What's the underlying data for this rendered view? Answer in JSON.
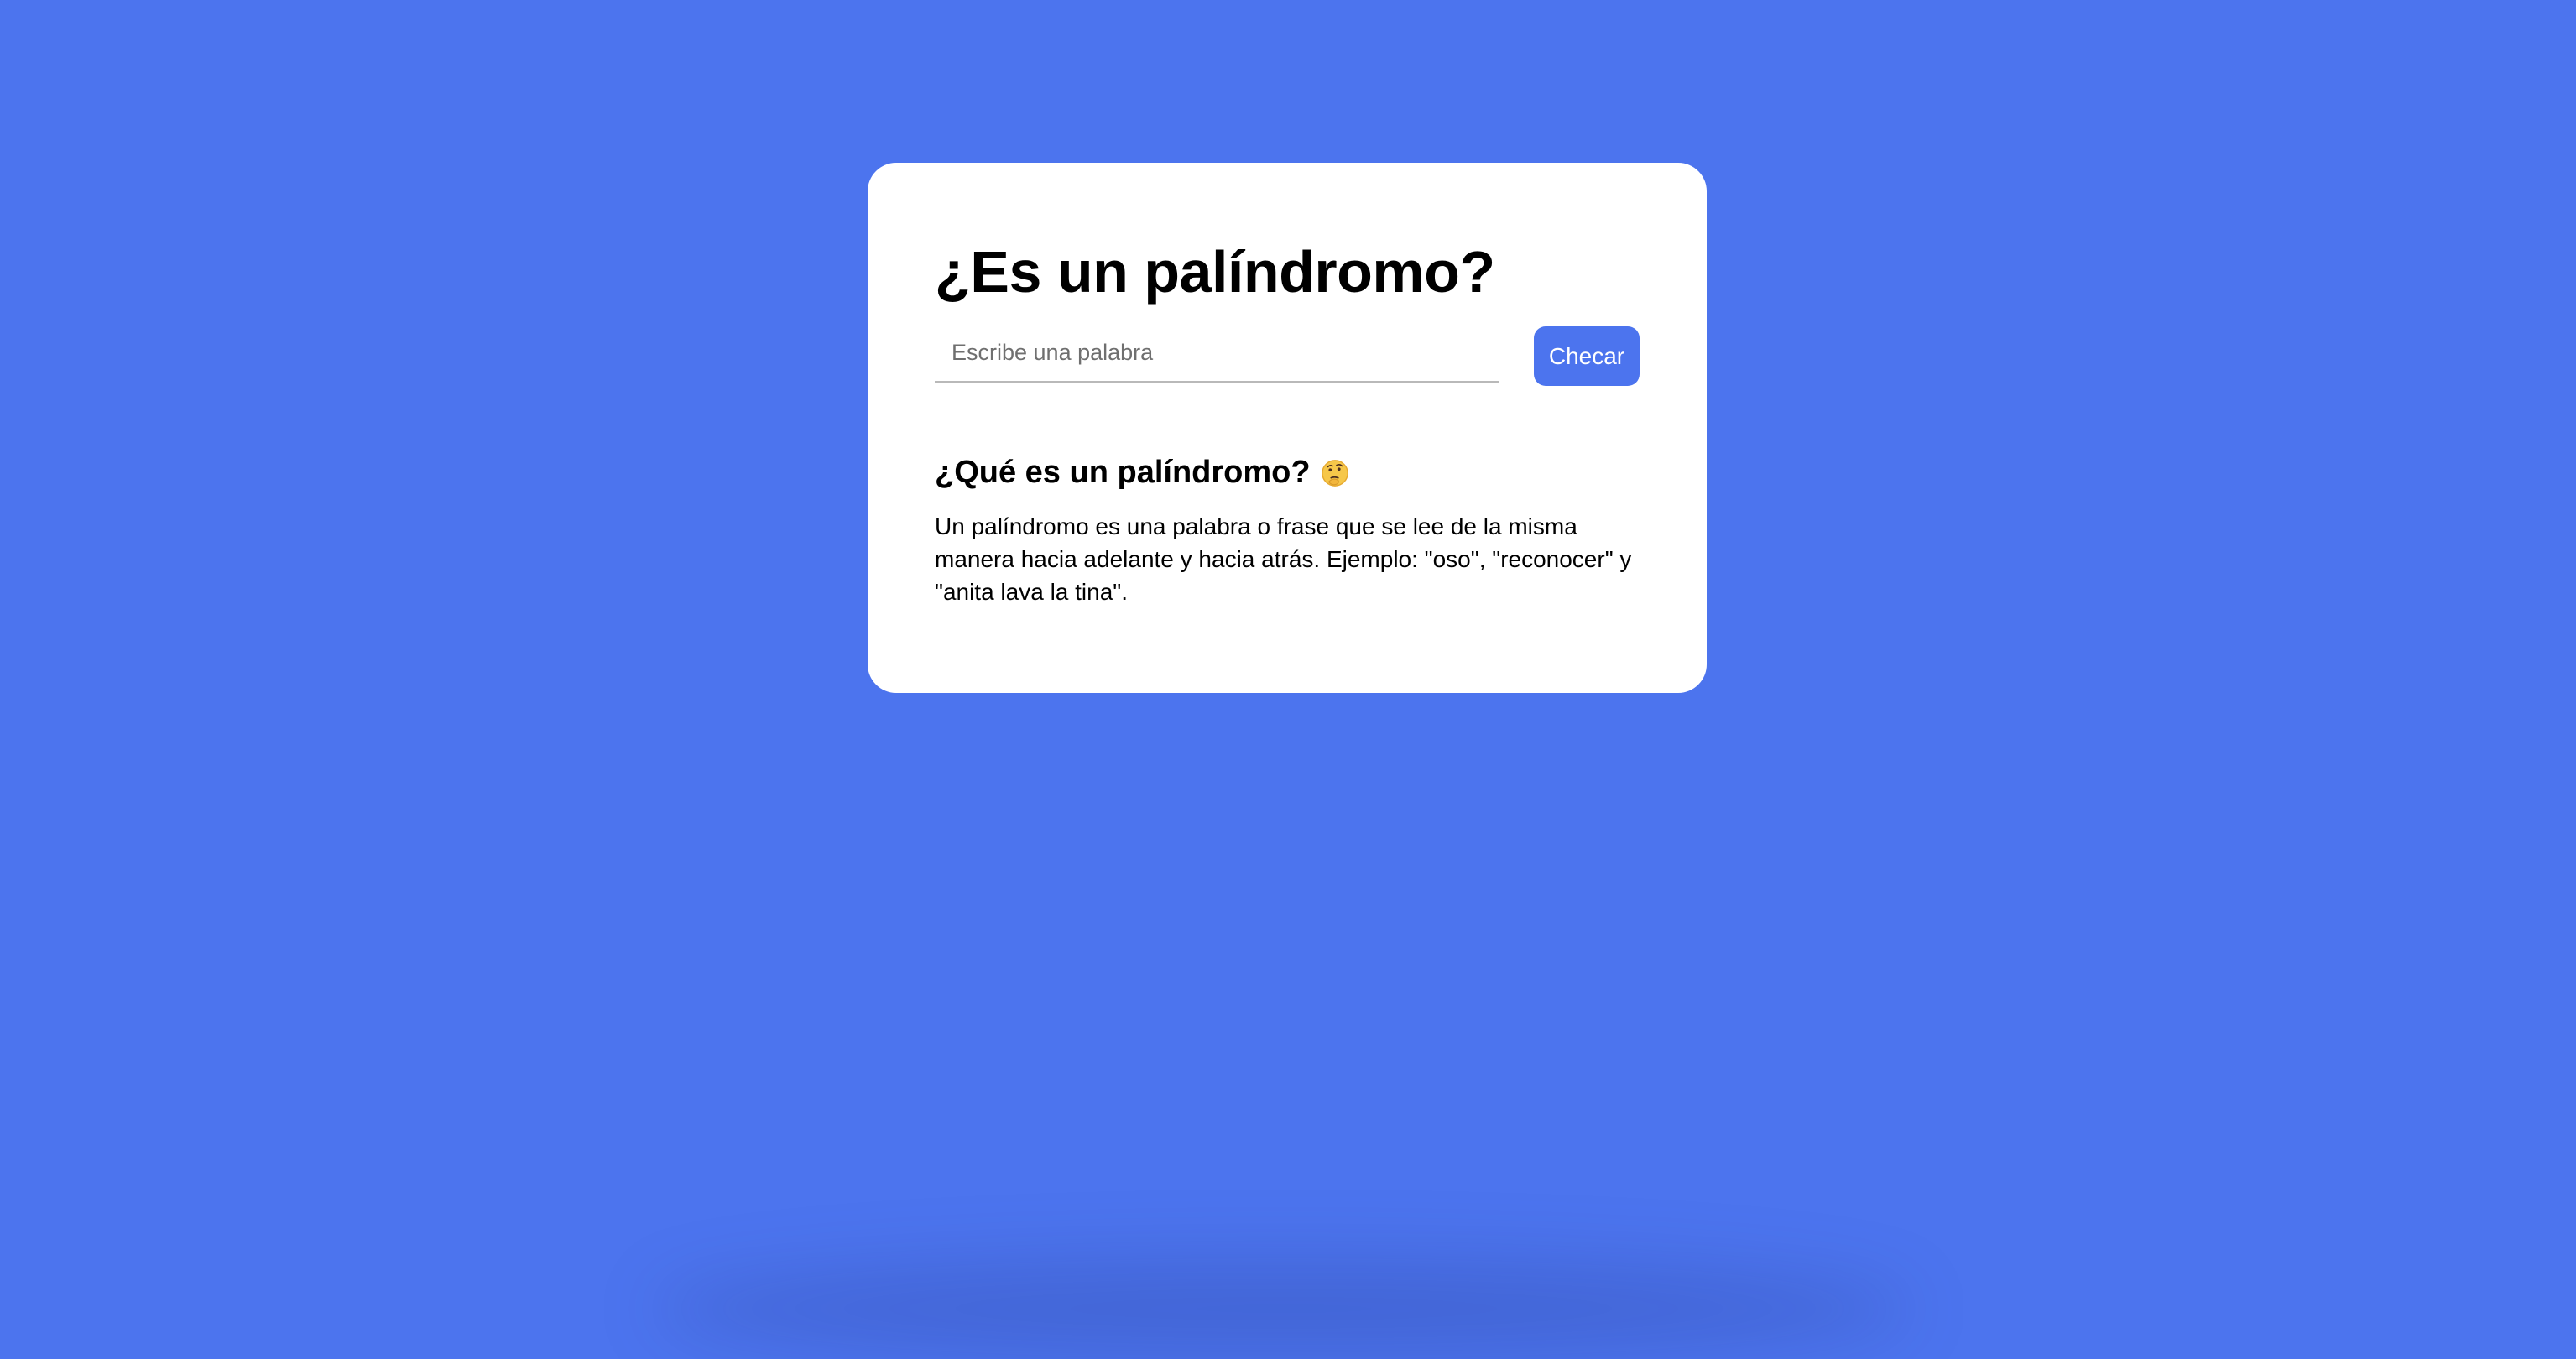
{
  "colors": {
    "background": "#4c74ee",
    "card": "#ffffff",
    "button": "#4c74ee",
    "button_text": "#ffffff",
    "text": "#000000"
  },
  "card": {
    "title": "¿Es un palíndromo?",
    "input": {
      "value": "",
      "placeholder": "Escribe una palabra"
    },
    "button_label": "Checar",
    "info": {
      "heading": "¿Qué es un palíndromo?",
      "heading_icon": "thinking-face-icon",
      "text": "Un palíndromo es una palabra o frase que se lee de la misma manera hacia adelante y hacia atrás. Ejemplo: \"oso\", \"reconocer\" y \"anita lava la tina\"."
    }
  }
}
